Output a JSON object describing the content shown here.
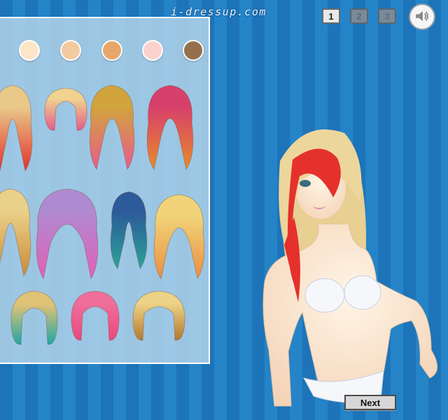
{
  "header": {
    "site_title": "i-dressup.com"
  },
  "pagination": {
    "pages": [
      {
        "label": "1",
        "active": true
      },
      {
        "label": "2",
        "active": false
      },
      {
        "label": "3",
        "active": false
      }
    ]
  },
  "sound": {
    "icon": "speaker-icon"
  },
  "skin_tones": [
    "#fde5c8",
    "#f4caa0",
    "#e7a76a",
    "#fcd2cf",
    "#94714c"
  ],
  "hair_styles": [
    {
      "name": "red-blonde-long",
      "colors": [
        "#e9c98a",
        "#e3322c"
      ]
    },
    {
      "name": "pink-buns",
      "colors": [
        "#f0d38e",
        "#e55a8a"
      ]
    },
    {
      "name": "blonde-pink-ombre",
      "colors": [
        "#d1a43c",
        "#e85b8e"
      ]
    },
    {
      "name": "pink-orange-ombre",
      "colors": [
        "#d7406b",
        "#e88a2a"
      ]
    },
    {
      "name": "blonde-stripes-partial",
      "colors": [
        "#ead189",
        "#c98b3a"
      ]
    },
    {
      "name": "purple-pigtails",
      "colors": [
        "#b08ad0",
        "#e060b8"
      ]
    },
    {
      "name": "blue-green-waves",
      "colors": [
        "#2d5a9a",
        "#2aa39a"
      ]
    },
    {
      "name": "blonde-layered",
      "colors": [
        "#f1d479",
        "#e88f42"
      ]
    },
    {
      "name": "teal-blonde-bob",
      "colors": [
        "#e0c276",
        "#1fa7a5"
      ]
    },
    {
      "name": "pink-bob",
      "colors": [
        "#f06e9a",
        "#e8487d"
      ]
    },
    {
      "name": "braided-updo",
      "colors": [
        "#ecd387",
        "#b4772f"
      ]
    }
  ],
  "footer": {
    "next_label": "Next"
  }
}
